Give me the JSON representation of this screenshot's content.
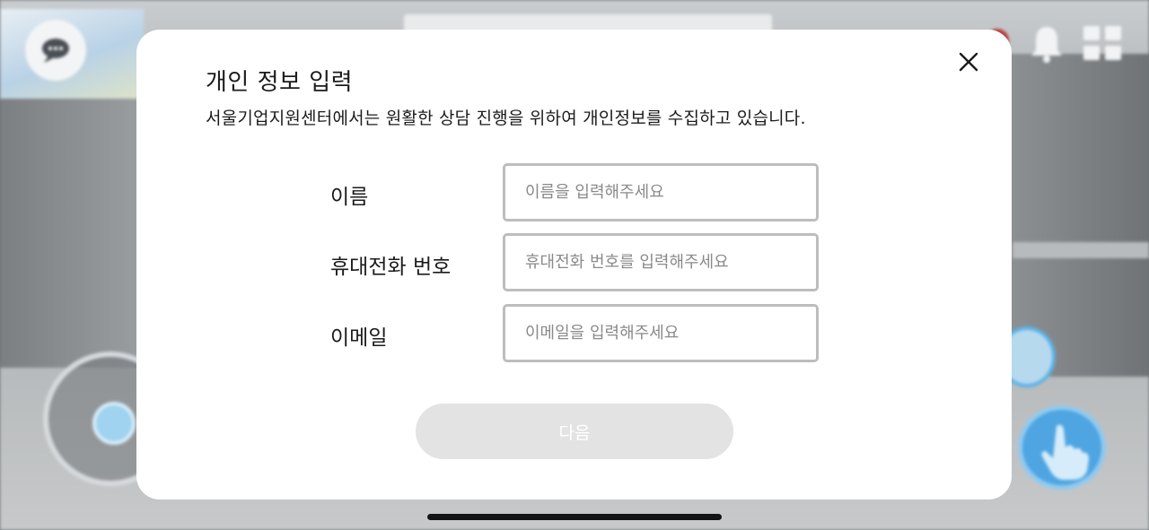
{
  "modal": {
    "title": "개인 정보 입력",
    "description": "서울기업지원센터에서는 원활한 상담 진행을 위하여 개인정보를 수집하고 있습니다.",
    "close_icon": "close-icon"
  },
  "form": {
    "fields": [
      {
        "label": "이름",
        "placeholder": "이름을 입력해주세요",
        "value": ""
      },
      {
        "label": "휴대전화 번호",
        "placeholder": "휴대전화 번호를 입력해주세요",
        "value": ""
      },
      {
        "label": "이메일",
        "placeholder": "이메일을 입력해주세요",
        "value": ""
      }
    ],
    "next_label": "다음"
  },
  "background_icons": [
    "chat-icon",
    "bell-icon",
    "grid-menu-icon",
    "joystick-icon",
    "hand-pointer-icon"
  ],
  "colors": {
    "input_border": "#bdbdbd",
    "button_disabled_bg": "#e3e3e3",
    "action_blue": "#4fa5e2"
  }
}
